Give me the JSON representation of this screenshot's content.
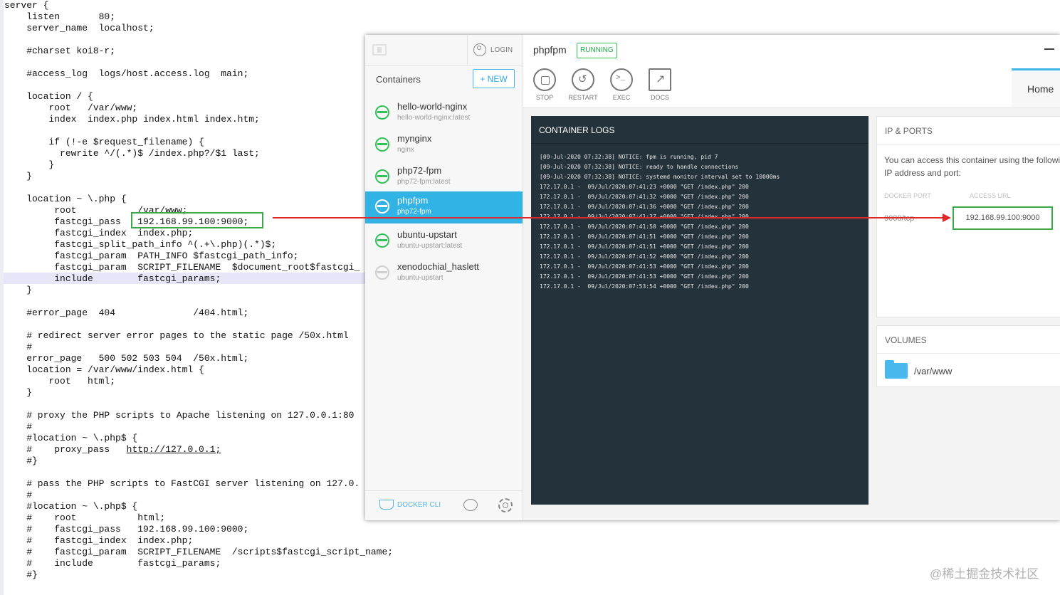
{
  "code_lines": [
    "server {",
    "    listen       80;",
    "    server_name  localhost;",
    "",
    "    #charset koi8-r;",
    "",
    "    #access_log  logs/host.access.log  main;",
    "",
    "    location / {",
    "        root   /var/www;",
    "        index  index.php index.html index.htm;",
    "",
    "        if (!-e $request_filename) {",
    "          rewrite ^/(.*)$ /index.php?/$1 last;",
    "        }",
    "    }",
    "",
    "    location ~ \\.php {",
    "         root           /var/www;",
    "         fastcgi_pass   192.168.99.100:9000;",
    "         fastcgi_index  index.php;",
    "         fastcgi_split_path_info ^(.+\\.php)(.*)$;",
    "         fastcgi_param  PATH_INFO $fastcgi_path_info;",
    "         fastcgi_param  SCRIPT_FILENAME  $document_root$fastcgi_",
    "         include        fastcgi_params;",
    "    }",
    "",
    "    #error_page  404              /404.html;",
    "",
    "    # redirect server error pages to the static page /50x.html",
    "    #",
    "    error_page   500 502 503 504  /50x.html;",
    "    location = /var/www/index.html {",
    "        root   html;",
    "    }",
    "",
    "    # proxy the PHP scripts to Apache listening on 127.0.0.1:80",
    "    #",
    "    #location ~ \\.php$ {",
    "    #    proxy_pass   ",
    "    #}",
    "",
    "    # pass the PHP scripts to FastCGI server listening on 127.0.",
    "    #",
    "    #location ~ \\.php$ {",
    "    #    root           html;",
    "    #    fastcgi_pass   192.168.99.100:9000;",
    "    #    fastcgi_index  index.php;",
    "    #    fastcgi_param  SCRIPT_FILENAME  /scripts$fastcgi_script_name;",
    "    #    include        fastcgi_params;",
    "    #}"
  ],
  "code_link": "http://127.0.0.1;",
  "sidebar": {
    "login_label": "LOGIN",
    "heading": "Containers",
    "new_label": "+ NEW",
    "containers": [
      {
        "name": "hello-world-nginx",
        "image": "hello-world-nginx:latest",
        "status": "running"
      },
      {
        "name": "mynginx",
        "image": "nginx",
        "status": "running"
      },
      {
        "name": "php72-fpm",
        "image": "php72-fpm:latest",
        "status": "running"
      },
      {
        "name": "phpfpm",
        "image": "php72-fpm",
        "status": "running",
        "selected": true
      },
      {
        "name": "ubuntu-upstart",
        "image": "ubuntu-upstart:latest",
        "status": "running"
      },
      {
        "name": "xenodochial_haslett",
        "image": "ubuntu-upstart",
        "status": "stopped"
      }
    ],
    "docker_cli_label": "DOCKER CLI"
  },
  "header": {
    "container_name": "phpfpm",
    "status_badge": "RUNNING",
    "tools": [
      "STOP",
      "RESTART",
      "EXEC",
      "DOCS"
    ],
    "home_tab": "Home"
  },
  "logs": {
    "title": "CONTAINER LOGS",
    "lines": [
      "[09-Jul-2020 07:32:38] NOTICE: fpm is running, pid 7",
      "[09-Jul-2020 07:32:38] NOTICE: ready to handle connections",
      "[09-Jul-2020 07:32:38] NOTICE: systemd monitor interval set to 10000ms",
      "172.17.0.1 -  09/Jul/2020:07:41:23 +0000 \"GET /index.php\" 200",
      "172.17.0.1 -  09/Jul/2020:07:41:32 +0000 \"GET /index.php\" 200",
      "172.17.0.1 -  09/Jul/2020:07:41:36 +0000 \"GET /index.php\" 200",
      "172.17.0.1 -  09/Jul/2020:07:41:37 +0000 \"GET /index.php\" 200",
      "172.17.0.1 -  09/Jul/2020:07:41:50 +0000 \"GET /index.php\" 200",
      "172.17.0.1 -  09/Jul/2020:07:41:51 +0000 \"GET /index.php\" 200",
      "172.17.0.1 -  09/Jul/2020:07:41:51 +0000 \"GET /index.php\" 200",
      "172.17.0.1 -  09/Jul/2020:07:41:52 +0000 \"GET /index.php\" 200",
      "172.17.0.1 -  09/Jul/2020:07:41:53 +0000 \"GET /index.php\" 200",
      "172.17.0.1 -  09/Jul/2020:07:41:53 +0000 \"GET /index.php\" 200",
      "172.17.0.1 -  09/Jul/2020:07:53:54 +0000 \"GET /index.php\" 200"
    ]
  },
  "ports": {
    "title": "IP & PORTS",
    "description": "You can access this container using the following IP address and port:",
    "col_docker_port": "DOCKER PORT",
    "col_access_url": "ACCESS URL",
    "docker_port": "9000/tcp",
    "access_url": "192.168.99.100:9000"
  },
  "volumes": {
    "title": "VOLUMES",
    "path": "/var/www"
  },
  "watermark": "@稀土掘金技术社区",
  "colors": {
    "accent": "#32b3e6",
    "running": "#34c159",
    "highlight_box": "#3da84a",
    "arrow": "#e02828",
    "logs_bg": "#24323b"
  }
}
